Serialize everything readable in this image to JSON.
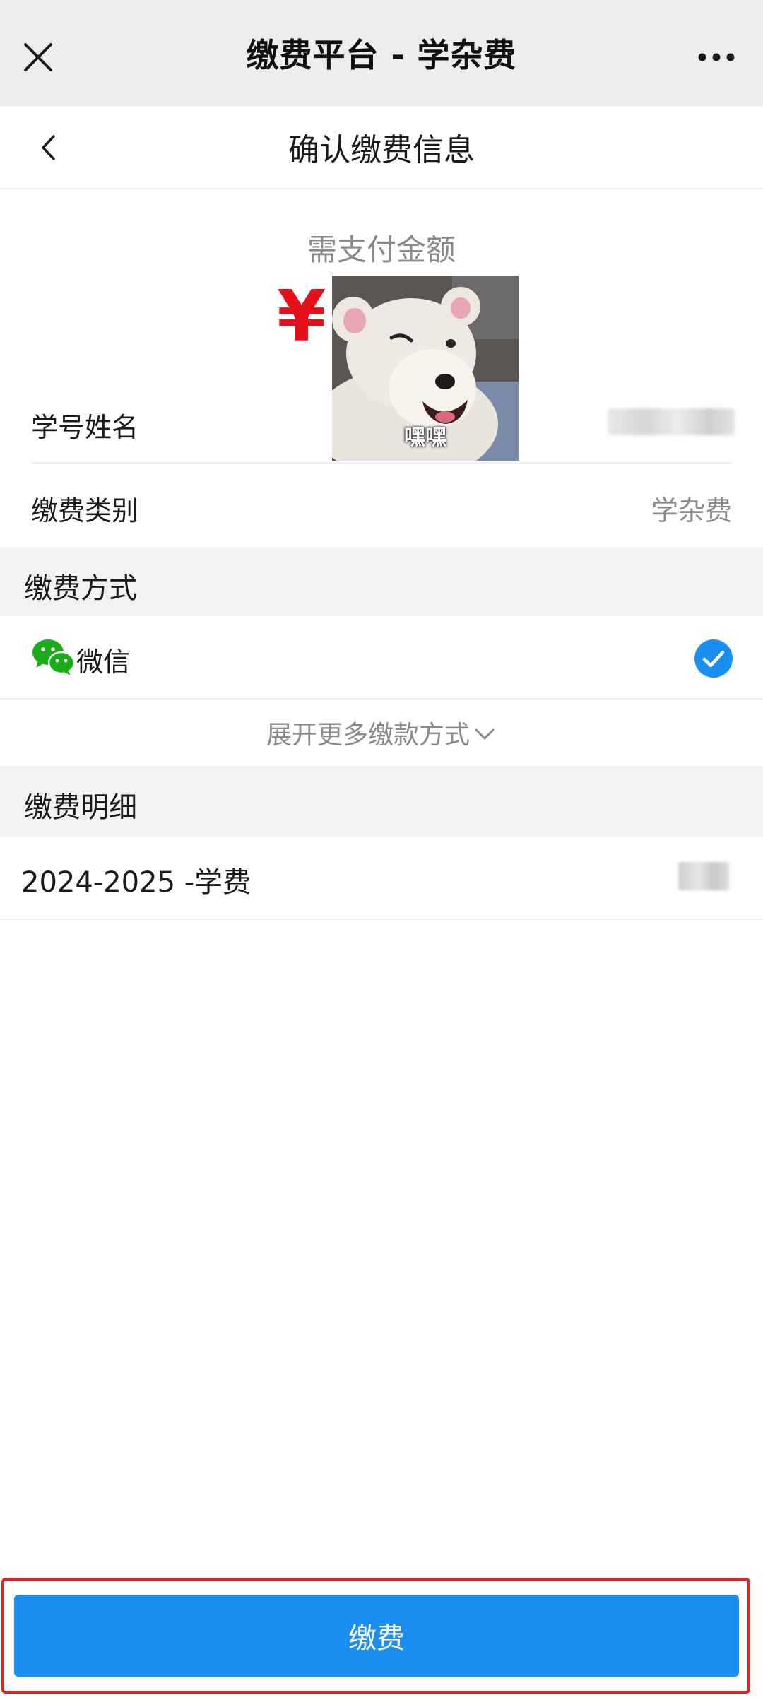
{
  "appbar": {
    "title": "缴费平台 - 学杂费",
    "close_icon": "close-icon",
    "more_icon": "more-icon"
  },
  "header": {
    "title": "确认缴费信息",
    "back_icon": "chevron-left-icon"
  },
  "amount": {
    "label": "需支付金额",
    "currency_symbol": "¥",
    "overlay_caption": "嘿嘿"
  },
  "info": {
    "student_label": "学号姓名",
    "category_label": "缴费类别",
    "category_value": "学杂费"
  },
  "payment_method": {
    "section_title": "缴费方式",
    "option_label": "微信",
    "option_icon": "wechat-icon",
    "selected": true,
    "expand_label": "展开更多缴款方式"
  },
  "fee_detail": {
    "section_title": "缴费明细",
    "item_label": "2024-2025 -学费"
  },
  "pay_button": {
    "label": "缴费"
  },
  "colors": {
    "accent": "#1b8ef2",
    "currency": "#e6101b",
    "wechat": "#1aad19",
    "highlight_border": "#e62222"
  }
}
